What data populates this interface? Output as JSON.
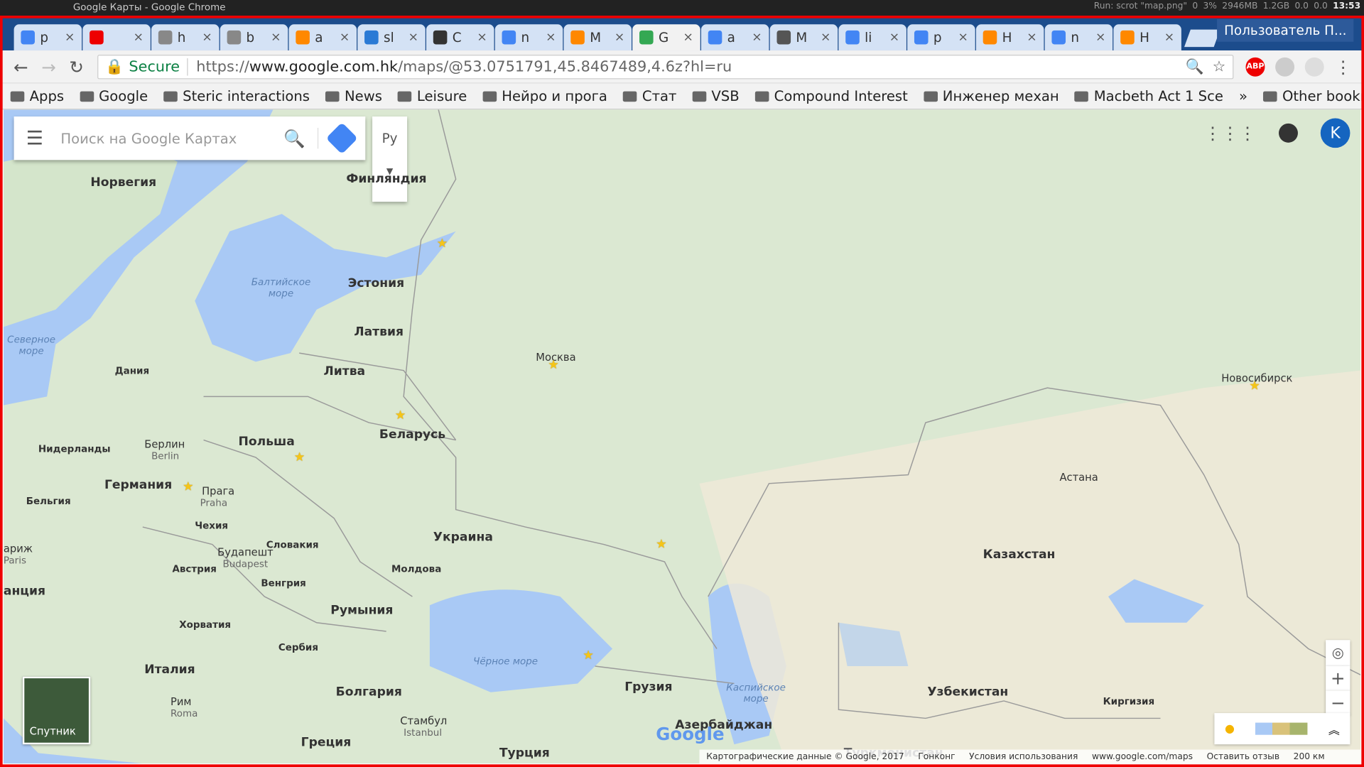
{
  "window_title": "Google Карты - Google Chrome",
  "sysbar": {
    "run": "Run: scrot \"map.png\"",
    "v1": "0",
    "cpu": "3%",
    "mem": "2946MB",
    "swap": "1.2GB",
    "n1": "0.0",
    "n2": "0.0",
    "time": "13:53"
  },
  "tabs": [
    {
      "t": "p",
      "color": "#4285f4"
    },
    {
      "t": "",
      "color": "#e00"
    },
    {
      "t": "h",
      "color": "#888"
    },
    {
      "t": "b",
      "color": "#888"
    },
    {
      "t": "a",
      "color": "#f80"
    },
    {
      "t": "sl",
      "color": "#2a7ad5"
    },
    {
      "t": "C",
      "color": "#333"
    },
    {
      "t": "n",
      "color": "#4285f4"
    },
    {
      "t": "M",
      "color": "#f80"
    },
    {
      "t": "G",
      "color": "#34a853"
    },
    {
      "t": "a",
      "color": "#4285f4"
    },
    {
      "t": "M",
      "color": "#555"
    },
    {
      "t": "li",
      "color": "#4285f4"
    },
    {
      "t": "p",
      "color": "#4285f4"
    },
    {
      "t": "H",
      "color": "#f80"
    },
    {
      "t": "n",
      "color": "#4285f4"
    },
    {
      "t": "H",
      "color": "#f80"
    }
  ],
  "profile": "Пользователь П...",
  "omnibar": {
    "secure": "Secure",
    "url_scheme": "https://",
    "url_host": "www.google.com.hk",
    "url_path": "/maps/@53.0751791,45.8467489,4.6z?hl=ru",
    "abp": "ABP"
  },
  "bookmarks": [
    "Apps",
    "Google",
    "Steric interactions",
    "News",
    "Leisure",
    "Нейро и прога",
    "Стат",
    "VSB",
    "Compound Interest",
    "Инженер механ",
    "Macbeth Act 1 Sce"
  ],
  "other_bookmarks": "Other bookmarks",
  "search": {
    "placeholder": "Поиск на Google Картах",
    "lang": "Ру"
  },
  "account_initial": "K",
  "satellite_label": "Спутник",
  "footer": {
    "data": "Картографические данные © Google, 2017",
    "region": "Гонконг",
    "terms": "Условия использования",
    "site": "www.google.com/maps",
    "feedback": "Оставить отзыв",
    "scale": "200 км"
  },
  "labels": {
    "norway": "Норвегия",
    "finland": "Финляндия",
    "estonia": "Эстония",
    "latvia": "Латвия",
    "lithuania": "Литва",
    "belarus": "Беларусь",
    "poland": "Польша",
    "germany": "Германия",
    "netherlands": "Нидерланды",
    "belgium": "Бельгия",
    "denmark": "Дания",
    "czech": "Чехия",
    "slovakia": "Словакия",
    "austria": "Австрия",
    "hungary": "Венгрия",
    "ukraine": "Украина",
    "moldova": "Молдова",
    "romania": "Румыния",
    "croatia": "Хорватия",
    "serbia": "Сербия",
    "italy": "Италия",
    "bulgaria": "Болгария",
    "greece": "Греция",
    "turkey": "Турция",
    "georgia": "Грузия",
    "azerbaijan": "Азербайджан",
    "kazakhstan": "Казахстан",
    "uzbekistan": "Узбекистан",
    "kyrgyzstan": "Киргизия",
    "france": "анция",
    "turkmen": "Туркменистан",
    "moscow": "Москва",
    "novosibirsk": "Новосибирск",
    "astana": "Астана",
    "berlin": "Берлин",
    "berlin_en": "Berlin",
    "prague": "Прага",
    "prague_en": "Praha",
    "budapest": "Будапешт",
    "budapest_en": "Budapest",
    "rome": "Рим",
    "rome_en": "Roma",
    "paris": "ариж",
    "paris_en": "Paris",
    "istanbul": "Стамбул",
    "istanbul_en": "Istanbul",
    "baltic_sea": "Балтийское море",
    "north_sea": "Северное море",
    "black_sea": "Чёрное море",
    "caspian_sea": "Каспийское море"
  }
}
